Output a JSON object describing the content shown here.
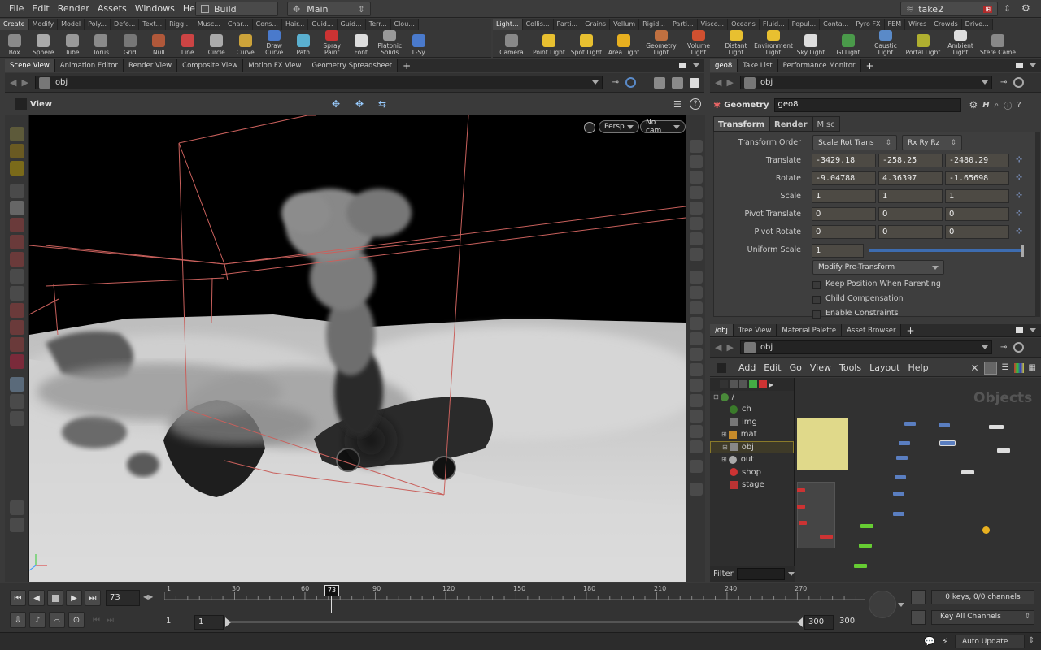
{
  "menu": [
    "File",
    "Edit",
    "Render",
    "Assets",
    "Windows",
    "Help"
  ],
  "desktop": {
    "name": "Build",
    "context": "Main",
    "take": "take2"
  },
  "shelf_left": {
    "tabs": [
      "Create",
      "Modify",
      "Model",
      "Poly...",
      "Defo...",
      "Text...",
      "Rigg...",
      "Musc...",
      "Char...",
      "Cons...",
      "Hair...",
      "Guid...",
      "Guid...",
      "Terr...",
      "Clou..."
    ],
    "tools": [
      "Box",
      "Sphere",
      "Tube",
      "Torus",
      "Grid",
      "Null",
      "Line",
      "Circle",
      "Curve",
      "Draw Curve",
      "Path",
      "Spray Paint",
      "Font",
      "Platonic Solids",
      "L-Sy"
    ]
  },
  "shelf_right": {
    "tabs": [
      "Light...",
      "Collis...",
      "Parti...",
      "Grains",
      "Vellum",
      "Rigid...",
      "Parti...",
      "Visco...",
      "Oceans",
      "Fluid...",
      "Popul...",
      "Conta...",
      "Pyro FX",
      "FEM",
      "Wires",
      "Crowds",
      "Drive..."
    ],
    "tools": [
      "Camera",
      "Point Light",
      "Spot Light",
      "Area Light",
      "Geometry Light",
      "Volume Light",
      "Distant Light",
      "Environment Light",
      "Sky Light",
      "GI Light",
      "Caustic Light",
      "Portal Light",
      "Ambient Light",
      "Stere Came"
    ]
  },
  "left_panes": {
    "tabs": [
      "Scene View",
      "Animation Editor",
      "Render View",
      "Composite View",
      "Motion FX View",
      "Geometry Spreadsheet"
    ],
    "path": "obj",
    "view_title": "View",
    "persp": "Persp",
    "cam": "No cam"
  },
  "params": {
    "tabs": [
      "geo8",
      "Take List",
      "Performance Monitor"
    ],
    "path": "obj",
    "node_type": "Geometry",
    "node_name": "geo8",
    "subtabs": [
      "Transform",
      "Render",
      "Misc"
    ],
    "transform_order_label": "Transform Order",
    "transform_order": "Scale Rot Trans",
    "rot_order": "Rx Ry Rz",
    "translate_label": "Translate",
    "translate": [
      "-3429.18",
      "-258.25",
      "-2480.29"
    ],
    "rotate_label": "Rotate",
    "rotate": [
      "-9.04788",
      "4.36397",
      "-1.65698"
    ],
    "scale_label": "Scale",
    "scale": [
      "1",
      "1",
      "1"
    ],
    "pivot_translate_label": "Pivot Translate",
    "pivot_translate": [
      "0",
      "0",
      "0"
    ],
    "pivot_rotate_label": "Pivot Rotate",
    "pivot_rotate": [
      "0",
      "0",
      "0"
    ],
    "uniform_scale_label": "Uniform Scale",
    "uniform_scale": "1",
    "modify_label": "Modify Pre-Transform",
    "checkboxes": [
      "Keep Position When Parenting",
      "Child Compensation",
      "Enable Constraints"
    ]
  },
  "network": {
    "tabs": [
      "/obj",
      "Tree View",
      "Material Palette",
      "Asset Browser"
    ],
    "path": "obj",
    "menu": [
      "Add",
      "Edit",
      "Go",
      "View",
      "Tools",
      "Layout",
      "Help"
    ],
    "context_label": "Objects",
    "tree_root": "/",
    "tree": [
      "ch",
      "img",
      "mat",
      "obj",
      "out",
      "shop",
      "stage"
    ],
    "filter_label": "Filter"
  },
  "timeline": {
    "frame": "73",
    "marker": "73",
    "ticks": [
      "1",
      "30",
      "60",
      "90",
      "120",
      "150",
      "180",
      "210",
      "240",
      "270"
    ],
    "range_start": "1",
    "range_start2": "1",
    "range_end": "300",
    "range_end2": "300",
    "keys_info": "0 keys, 0/0 channels",
    "key_all": "Key All Channels",
    "auto_update": "Auto Update"
  }
}
